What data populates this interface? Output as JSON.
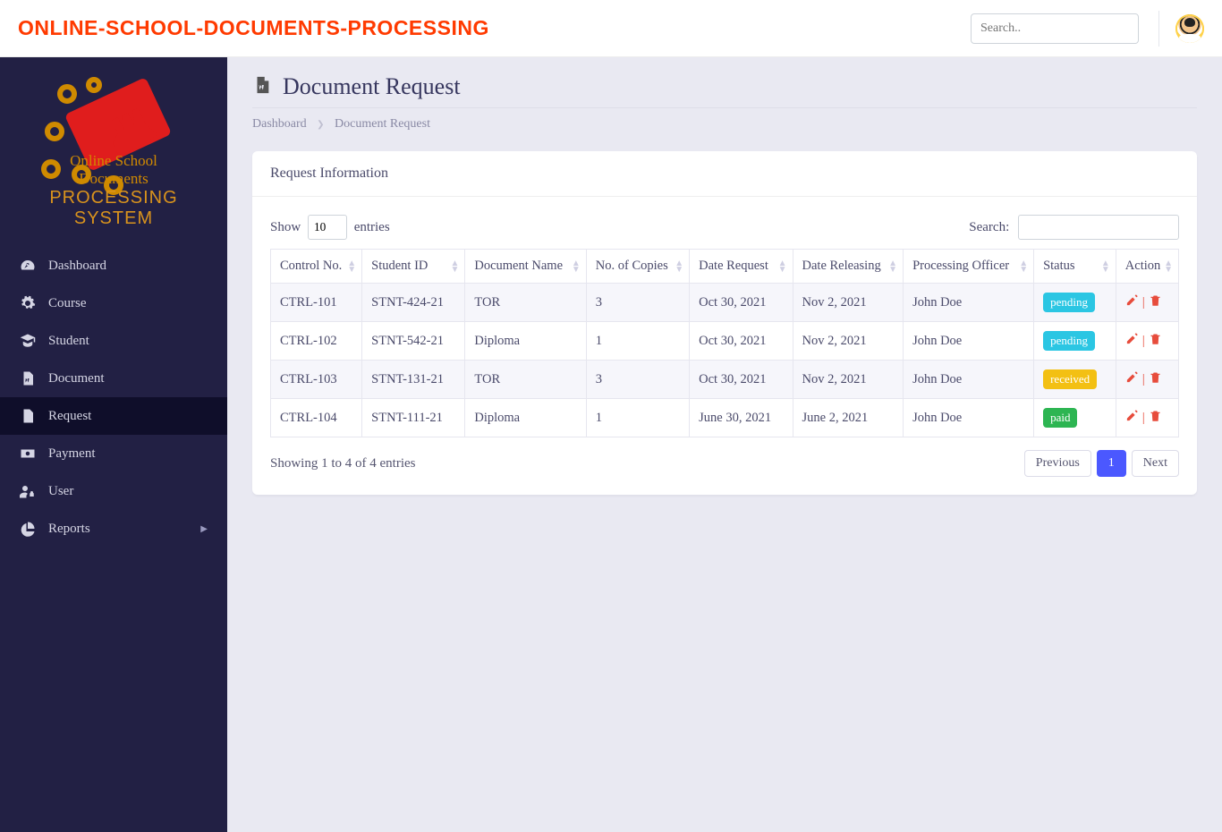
{
  "brand": "ONLINE-SCHOOL-DOCUMENTS-PROCESSING",
  "topSearchPlaceholder": "Search..",
  "logo": {
    "line1": "Online School Documents",
    "line2": "PROCESSING SYSTEM"
  },
  "sidebar": {
    "items": [
      {
        "label": "Dashboard",
        "icon": "tachometer-icon"
      },
      {
        "label": "Course",
        "icon": "cog-icon"
      },
      {
        "label": "Student",
        "icon": "graduate-icon"
      },
      {
        "label": "Document",
        "icon": "file-word-icon"
      },
      {
        "label": "Request",
        "icon": "file-icon"
      },
      {
        "label": "Payment",
        "icon": "money-icon"
      },
      {
        "label": "User",
        "icon": "users-lock-icon"
      },
      {
        "label": "Reports",
        "icon": "pie-chart-icon"
      }
    ]
  },
  "page": {
    "title": "Document Request",
    "breadcrumb": {
      "root": "Dashboard",
      "current": "Document Request"
    },
    "cardTitle": "Request Information"
  },
  "datatable": {
    "lengthPrefix": "Show",
    "lengthValue": "10",
    "lengthSuffix": "entries",
    "searchLabel": "Search:",
    "headers": [
      "Control No.",
      "Student ID",
      "Document Name",
      "No. of Copies",
      "Date Request",
      "Date Releasing",
      "Processing Officer",
      "Status",
      "Action"
    ],
    "rows": [
      {
        "control": "CTRL-101",
        "student": "STNT-424-21",
        "doc": "TOR",
        "copies": "3",
        "req": "Oct 30, 2021",
        "rel": "Nov 2, 2021",
        "officer": "John Doe",
        "status": "pending",
        "statusClass": "pending"
      },
      {
        "control": "CTRL-102",
        "student": "STNT-542-21",
        "doc": "Diploma",
        "copies": "1",
        "req": "Oct 30, 2021",
        "rel": "Nov 2, 2021",
        "officer": "John Doe",
        "status": "pending",
        "statusClass": "pending"
      },
      {
        "control": "CTRL-103",
        "student": "STNT-131-21",
        "doc": "TOR",
        "copies": "3",
        "req": "Oct 30, 2021",
        "rel": "Nov 2, 2021",
        "officer": "John Doe",
        "status": "received",
        "statusClass": "received"
      },
      {
        "control": "CTRL-104",
        "student": "STNT-111-21",
        "doc": "Diploma",
        "copies": "1",
        "req": "June 30, 2021",
        "rel": "June 2, 2021",
        "officer": "John Doe",
        "status": "paid",
        "statusClass": "paid"
      }
    ],
    "info": "Showing 1 to 4 of 4 entries",
    "pagination": {
      "prev": "Previous",
      "page": "1",
      "next": "Next"
    }
  }
}
